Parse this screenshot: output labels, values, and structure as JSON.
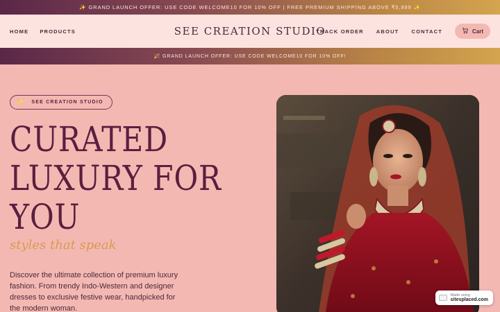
{
  "topbar": {
    "text": "✨ GRAND LAUNCH OFFER: USE CODE WELCOME10 FOR 10% OFF | FREE PREMIUM SHIPPING ABOVE ₹5,999 ✨"
  },
  "nav": {
    "left": [
      "HOME",
      "PRODUCTS"
    ],
    "brand": "SEE CREATION STUDIO",
    "right": [
      "TRACK ORDER",
      "ABOUT",
      "CONTACT"
    ],
    "cart_label": "Cart"
  },
  "promo": {
    "text": "🎉 GRAND LAUNCH OFFER: USE CODE WELCOME10 FOR 10% OFF!"
  },
  "hero": {
    "pill_icon": "✨",
    "pill_label": "SEE CREATION STUDIO",
    "headline": [
      "CURATED",
      "LUXURY FOR",
      "YOU"
    ],
    "tagline": "styles that speak",
    "description": "Discover the ultimate collection of premium luxury fashion. From trendy Indo-Western and designer dresses to exclusive festive wear, handpicked for the modern woman."
  },
  "badge": {
    "made_using": "Made using",
    "site": "sitesplaced.com"
  },
  "colors": {
    "background": "#f4b8b3",
    "nav_background": "#fde3df",
    "accent_dark": "#5a1f3f",
    "accent_gold": "#d99a4e"
  },
  "icons": {
    "cart": "shopping-cart-icon",
    "pill": "sparkle-icon"
  }
}
